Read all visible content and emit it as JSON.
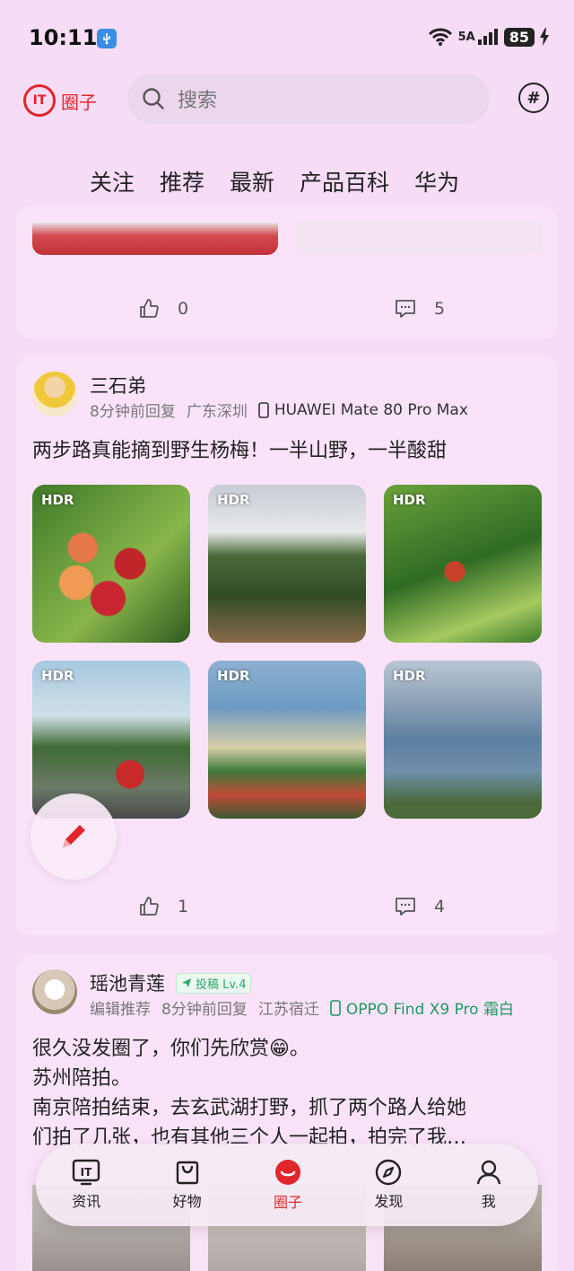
{
  "status": {
    "time": "10:11",
    "network": "5A",
    "battery": "85"
  },
  "header": {
    "logo_text": "圈子",
    "logo_mark": "IT",
    "search_placeholder": "搜索"
  },
  "tabs": [
    {
      "label": "关注"
    },
    {
      "label": "推荐"
    },
    {
      "label": "最新",
      "active": true
    },
    {
      "label": "产品百科"
    },
    {
      "label": "华为"
    }
  ],
  "post_prev": {
    "likes": "0",
    "comments": "5"
  },
  "post1": {
    "user": "三石弟",
    "time": "8分钟前回复",
    "location": "广东深圳",
    "device": "HUAWEI Mate 80 Pro Max",
    "text": "两步路真能摘到野生杨梅！一半山野，一半酸甜",
    "thumb_badge": "HDR",
    "likes": "1",
    "comments": "4"
  },
  "post2": {
    "user": "瑶池青莲",
    "tag": "投稿 Lv.4",
    "editor_pick": "编辑推荐",
    "time": "8分钟前回复",
    "location": "江苏宿迁",
    "device": "OPPO Find X9 Pro 霜白",
    "line1": "很久没发圈了，你们先欣赏😁。",
    "line2": "苏州陪拍。",
    "line3": "南京陪拍结束，去玄武湖打野，抓了两个路人给她",
    "line4": "们拍了几张，也有其他三个人一起拍，拍完了我…"
  },
  "nav": [
    {
      "label": "资讯",
      "icon": "it-news-icon"
    },
    {
      "label": "好物",
      "icon": "shopping-bag-icon"
    },
    {
      "label": "圈子",
      "icon": "circle-smile-icon",
      "active": true
    },
    {
      "label": "发现",
      "icon": "compass-icon"
    },
    {
      "label": "我",
      "icon": "person-icon"
    }
  ],
  "colors": {
    "accent": "#e0262a",
    "background": "#f7dcf5",
    "card": "#fae3f8"
  }
}
